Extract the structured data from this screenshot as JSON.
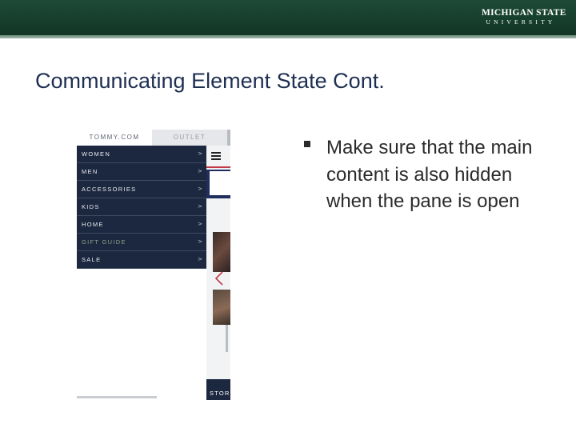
{
  "header": {
    "logo_line1": "MICHIGAN STATE",
    "logo_line2": "UNIVERSITY"
  },
  "slide": {
    "title": "Communicating Element State Cont.",
    "bullet": "Make sure that the main content is also hidden when the pane is open"
  },
  "screenshot": {
    "tabs": [
      "TOMMY.COM",
      "OUTLET"
    ],
    "nav_items": [
      {
        "label": "WOMEN",
        "chevron": ">"
      },
      {
        "label": "MEN",
        "chevron": ">"
      },
      {
        "label": "ACCESSORIES",
        "chevron": ">"
      },
      {
        "label": "KIDS",
        "chevron": ">"
      },
      {
        "label": "HOME",
        "chevron": ">"
      },
      {
        "label": "GIFT GUIDE",
        "chevron": ">"
      },
      {
        "label": "SALE",
        "chevron": ">"
      }
    ],
    "store_label": "STOR"
  },
  "colors": {
    "header_green": "#173f2e",
    "title_navy": "#1f2f52",
    "nav_pane": "#1c2840",
    "accent_red": "#c23a45"
  }
}
